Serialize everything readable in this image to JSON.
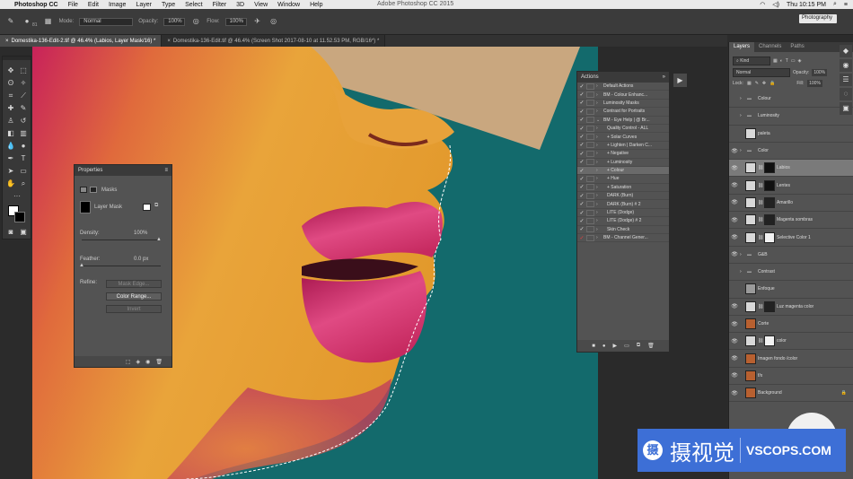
{
  "menubar": {
    "apple": "",
    "app": "Photoshop CC",
    "items": [
      "File",
      "Edit",
      "Image",
      "Layer",
      "Type",
      "Select",
      "Filter",
      "3D",
      "View",
      "Window",
      "Help"
    ],
    "center_title": "Adobe Photoshop CC 2015",
    "clock": "Thu 10:15 PM"
  },
  "options": {
    "mode_label": "Mode:",
    "mode_value": "Normal",
    "opacity_label": "Opacity:",
    "opacity_value": "100%",
    "flow_label": "Flow:",
    "flow_value": "100%",
    "workspace": "Photography",
    "brush_size": "81"
  },
  "doc_tabs": [
    "Domestika-136-Edit-2.tif @ 46.4% (Labios, Layer Mask/16) *",
    "Domestika-136-Edit.tif @ 46.4% (Screen Shot 2017-08-10 at 11.52.53 PM, RGB/16*) *"
  ],
  "properties": {
    "title": "Properties",
    "masks_label": "Masks",
    "layer_mask": "Layer Mask",
    "density_label": "Density:",
    "density_value": "100%",
    "density_level": 1.0,
    "feather_label": "Feather:",
    "feather_value": "0.0 px",
    "feather_level": 0.0,
    "refine_label": "Refine:",
    "mask_edge": "Mask Edge...",
    "color_range": "Color Range...",
    "invert": "Invert"
  },
  "actions": {
    "title": "Actions",
    "rows": [
      {
        "label": "Default Actions",
        "ck": "✓",
        "tri": "›",
        "red": false
      },
      {
        "label": "BM - Colour Enhanc...",
        "ck": "✓",
        "tri": "›",
        "red": false
      },
      {
        "label": "Luminosity Masks",
        "ck": "✓",
        "tri": "›",
        "red": false
      },
      {
        "label": "Contrast for Portraits",
        "ck": "✓",
        "tri": "›",
        "red": false
      },
      {
        "label": "BM - Eye Help | @ Br...",
        "ck": "✓",
        "tri": "⌄",
        "red": false
      },
      {
        "label": "Quality Control - ALL",
        "ck": "✓",
        "tri": "›",
        "red": false
      },
      {
        "label": "+ Solar Curves",
        "ck": "✓",
        "tri": "›",
        "red": false
      },
      {
        "label": "+ Lighten | Darken C...",
        "ck": "✓",
        "tri": "›",
        "red": false
      },
      {
        "label": "+ Negative",
        "ck": "✓",
        "tri": "›",
        "red": false
      },
      {
        "label": "+ Luminosity",
        "ck": "✓",
        "tri": "›",
        "red": false
      },
      {
        "label": "+ Colour",
        "ck": "✓",
        "tri": "›",
        "red": false
      },
      {
        "label": "+ Hue",
        "ck": "✓",
        "tri": "›",
        "red": false
      },
      {
        "label": "+ Saturation",
        "ck": "✓",
        "tri": "›",
        "red": false
      },
      {
        "label": "DARK (Burn)",
        "ck": "✓",
        "tri": "›",
        "red": false
      },
      {
        "label": "DARK (Burn) # 2",
        "ck": "✓",
        "tri": "›",
        "red": false
      },
      {
        "label": "LITE (Dodge)",
        "ck": "✓",
        "tri": "›",
        "red": false
      },
      {
        "label": "LITE (Dodge) # 2",
        "ck": "✓",
        "tri": "›",
        "red": false
      },
      {
        "label": "Skin Check",
        "ck": "✓",
        "tri": "›",
        "red": false
      },
      {
        "label": "BM - Channel Gener...",
        "ck": "✓",
        "tri": "›",
        "red": true
      }
    ],
    "selected_index": 10
  },
  "layers": {
    "tabs": [
      "Layers",
      "Channels",
      "Paths"
    ],
    "filter": "Kind",
    "blend": "Normal",
    "opacity_label": "Opacity:",
    "opacity_value": "100%",
    "lock_label": "Lock:",
    "fill_label": "Fill:",
    "fill_value": "100%",
    "rows": [
      {
        "name": "Colour",
        "kind": "folder",
        "eye": "",
        "thumb": "#2e2e2e"
      },
      {
        "name": "Luminosity",
        "kind": "folder",
        "eye": "",
        "thumb": "#2e2e2e"
      },
      {
        "name": "paleta",
        "kind": "layer",
        "eye": "",
        "thumb": "#d8d8d8"
      },
      {
        "name": "Color",
        "kind": "folder",
        "eye": "👁",
        "thumb": "#2e2e2e"
      },
      {
        "name": "Labios",
        "kind": "adj",
        "eye": "👁",
        "thumb": "#111"
      },
      {
        "name": "Lentes",
        "kind": "adj",
        "eye": "👁",
        "thumb": "#111"
      },
      {
        "name": "Amarillo",
        "kind": "adj",
        "eye": "👁",
        "thumb": "#222"
      },
      {
        "name": "Magenta sombras",
        "kind": "adj",
        "eye": "👁",
        "thumb": "#222"
      },
      {
        "name": "Selective Color 1",
        "kind": "adj",
        "eye": "👁",
        "thumb": "#f2f2f2"
      },
      {
        "name": "G&B",
        "kind": "folder",
        "eye": "👁",
        "thumb": "#2e2e2e"
      },
      {
        "name": "Contrast",
        "kind": "folder",
        "eye": "",
        "thumb": "#2e2e2e"
      },
      {
        "name": "Enfoque",
        "kind": "layer",
        "eye": "",
        "thumb": "#9a9a9a"
      },
      {
        "name": "Luz magenta color",
        "kind": "adj",
        "eye": "👁",
        "thumb": "#222"
      },
      {
        "name": "Corte",
        "kind": "layer",
        "eye": "👁",
        "thumb": "#b86030"
      },
      {
        "name": "color",
        "kind": "adj",
        "eye": "👁",
        "thumb": "#f2f2f2"
      },
      {
        "name": "Imagen fondo /color",
        "kind": "layer",
        "eye": "👁",
        "thumb": "#b86030"
      },
      {
        "name": "f/x",
        "kind": "layer",
        "eye": "👁",
        "thumb": "#b86030"
      },
      {
        "name": "Background",
        "kind": "layer",
        "eye": "👁",
        "thumb": "#b86030"
      }
    ],
    "selected_index": 4
  },
  "watermark": {
    "logo": "摄",
    "cn": "摄视觉",
    "en": "VSCOPS.COM"
  }
}
